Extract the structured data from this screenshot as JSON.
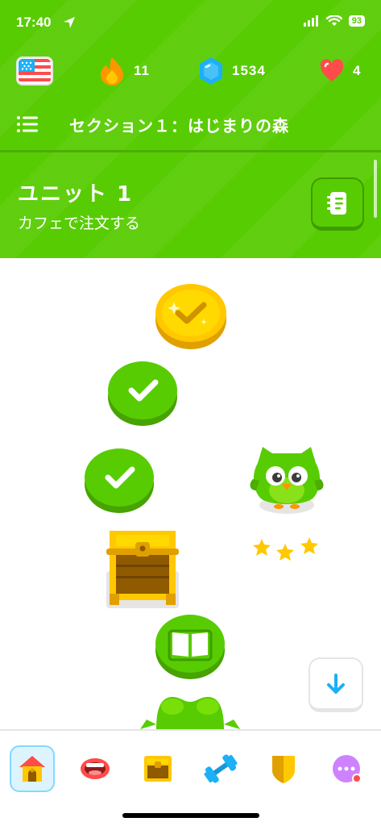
{
  "status_bar": {
    "time": "17:40",
    "battery": "93"
  },
  "stats": {
    "language_flag": "us-flag-icon",
    "streak": "11",
    "gems": "1534",
    "hearts": "4"
  },
  "section": {
    "title": "セクション１：はじまりの森"
  },
  "unit": {
    "title": "ユニット 1",
    "subtitle": "カフェで注文する",
    "guide_icon": "notebook-icon"
  },
  "path_nodes": [
    {
      "type": "legendary-coin",
      "state": "completed"
    },
    {
      "type": "lesson",
      "state": "completed"
    },
    {
      "type": "lesson",
      "state": "completed"
    },
    {
      "type": "treasure-chest",
      "state": "unopened"
    },
    {
      "type": "story",
      "state": "current"
    },
    {
      "type": "character",
      "state": "locked"
    }
  ],
  "mascot": {
    "name": "duo-owl",
    "stars": 3
  },
  "tabs": [
    {
      "name": "home",
      "icon": "home-icon",
      "active": true
    },
    {
      "name": "speaking",
      "icon": "mouth-icon",
      "active": false
    },
    {
      "name": "treasure",
      "icon": "chest-icon",
      "active": false
    },
    {
      "name": "practice",
      "icon": "dumbbell-icon",
      "active": false
    },
    {
      "name": "leagues",
      "icon": "shield-icon",
      "active": false
    },
    {
      "name": "more",
      "icon": "more-icon",
      "active": false
    }
  ],
  "colors": {
    "brand_green": "#58cc02",
    "gold": "#ffc800",
    "streak_orange": "#ff9600",
    "gem_blue": "#1cb0f6",
    "heart_red": "#ff4b4b"
  }
}
